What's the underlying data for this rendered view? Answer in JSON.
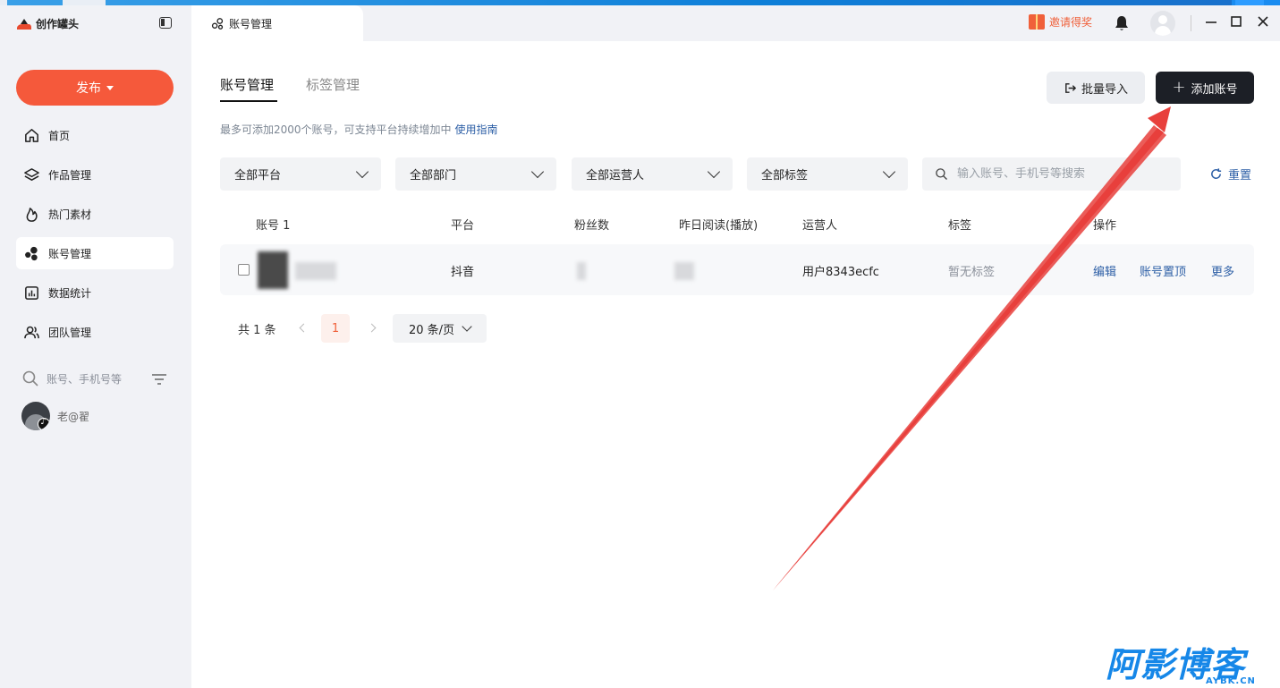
{
  "app": {
    "logo_text": "创作罐头",
    "publish_label": "发布",
    "page_tab_label": "账号管理"
  },
  "sidebar": {
    "items": [
      {
        "label": "首页",
        "icon": "home-icon"
      },
      {
        "label": "作品管理",
        "icon": "layers-icon"
      },
      {
        "label": "热门素材",
        "icon": "flame-icon"
      },
      {
        "label": "账号管理",
        "icon": "accounts-icon",
        "active": true
      },
      {
        "label": "数据统计",
        "icon": "chart-icon"
      },
      {
        "label": "团队管理",
        "icon": "team-icon"
      }
    ],
    "search_placeholder": "账号、手机号等",
    "account_name": "老@翟"
  },
  "header": {
    "invite_label": "邀请得奖"
  },
  "main": {
    "tabs": [
      {
        "label": "账号管理",
        "active": true
      },
      {
        "label": "标签管理",
        "active": false
      }
    ],
    "batch_import_label": "批量导入",
    "add_account_label": "添加账号",
    "notice_text": "最多可添加2000个账号，可支持平台持续增加中",
    "notice_link": "使用指南",
    "filters": [
      "全部平台",
      "全部部门",
      "全部运营人",
      "全部标签"
    ],
    "search_placeholder": "输入账号、手机号等搜索",
    "reset_label": "重置",
    "table": {
      "headers": [
        "账号 1",
        "平台",
        "粉丝数",
        "昨日阅读(播放)",
        "运营人",
        "标签",
        "操作"
      ],
      "rows": [
        {
          "platform": "抖音",
          "operator": "用户8343ecfc",
          "tags": "暂无标签",
          "actions": [
            "编辑",
            "账号置顶",
            "更多"
          ]
        }
      ]
    },
    "pagination": {
      "total_text": "共 1 条",
      "current_page": "1",
      "page_size": "20 条/页"
    }
  },
  "watermark": {
    "text": "阿影博客",
    "sub": "AYBK.CN"
  },
  "colors": {
    "brand": "#f5593b",
    "primary_dark": "#1c1f26",
    "link": "#2d5fa6",
    "annotation_arrow": "#e8403c",
    "watermark": "#1687e8"
  }
}
